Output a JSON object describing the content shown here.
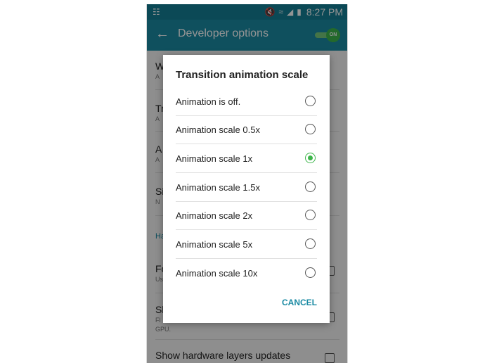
{
  "status_bar": {
    "left_icon": "notification-icon",
    "icons": [
      "mute-icon",
      "wifi-icon",
      "signal-icon",
      "battery-icon"
    ],
    "time": "8:27 PM"
  },
  "app_bar": {
    "title": "Developer options",
    "toggle_label": "ON",
    "toggle_on": true
  },
  "background_list": {
    "items": [
      {
        "title": "W",
        "subtitle": "A"
      },
      {
        "title": "Tr",
        "subtitle": "A"
      },
      {
        "title": "A",
        "subtitle": "A"
      },
      {
        "title": "Si",
        "subtitle": "N"
      }
    ],
    "section_header": "Ha",
    "items2": [
      {
        "title": "Fo",
        "subtitle": "Us"
      },
      {
        "title": "Sl",
        "subtitle": "Fl",
        "subtitle2": "GPU."
      }
    ],
    "bottom_item": "Show hardware layers updates"
  },
  "dialog": {
    "title": "Transition animation scale",
    "options": [
      {
        "label": "Animation is off.",
        "selected": false
      },
      {
        "label": "Animation scale 0.5x",
        "selected": false
      },
      {
        "label": "Animation scale 1x",
        "selected": true
      },
      {
        "label": "Animation scale 1.5x",
        "selected": false
      },
      {
        "label": "Animation scale 2x",
        "selected": false
      },
      {
        "label": "Animation scale 5x",
        "selected": false
      },
      {
        "label": "Animation scale 10x",
        "selected": false
      }
    ],
    "cancel_label": "CANCEL"
  },
  "colors": {
    "accent": "#1a8aa3",
    "statusbar": "#147e94",
    "radio_selected": "#3db54a"
  }
}
